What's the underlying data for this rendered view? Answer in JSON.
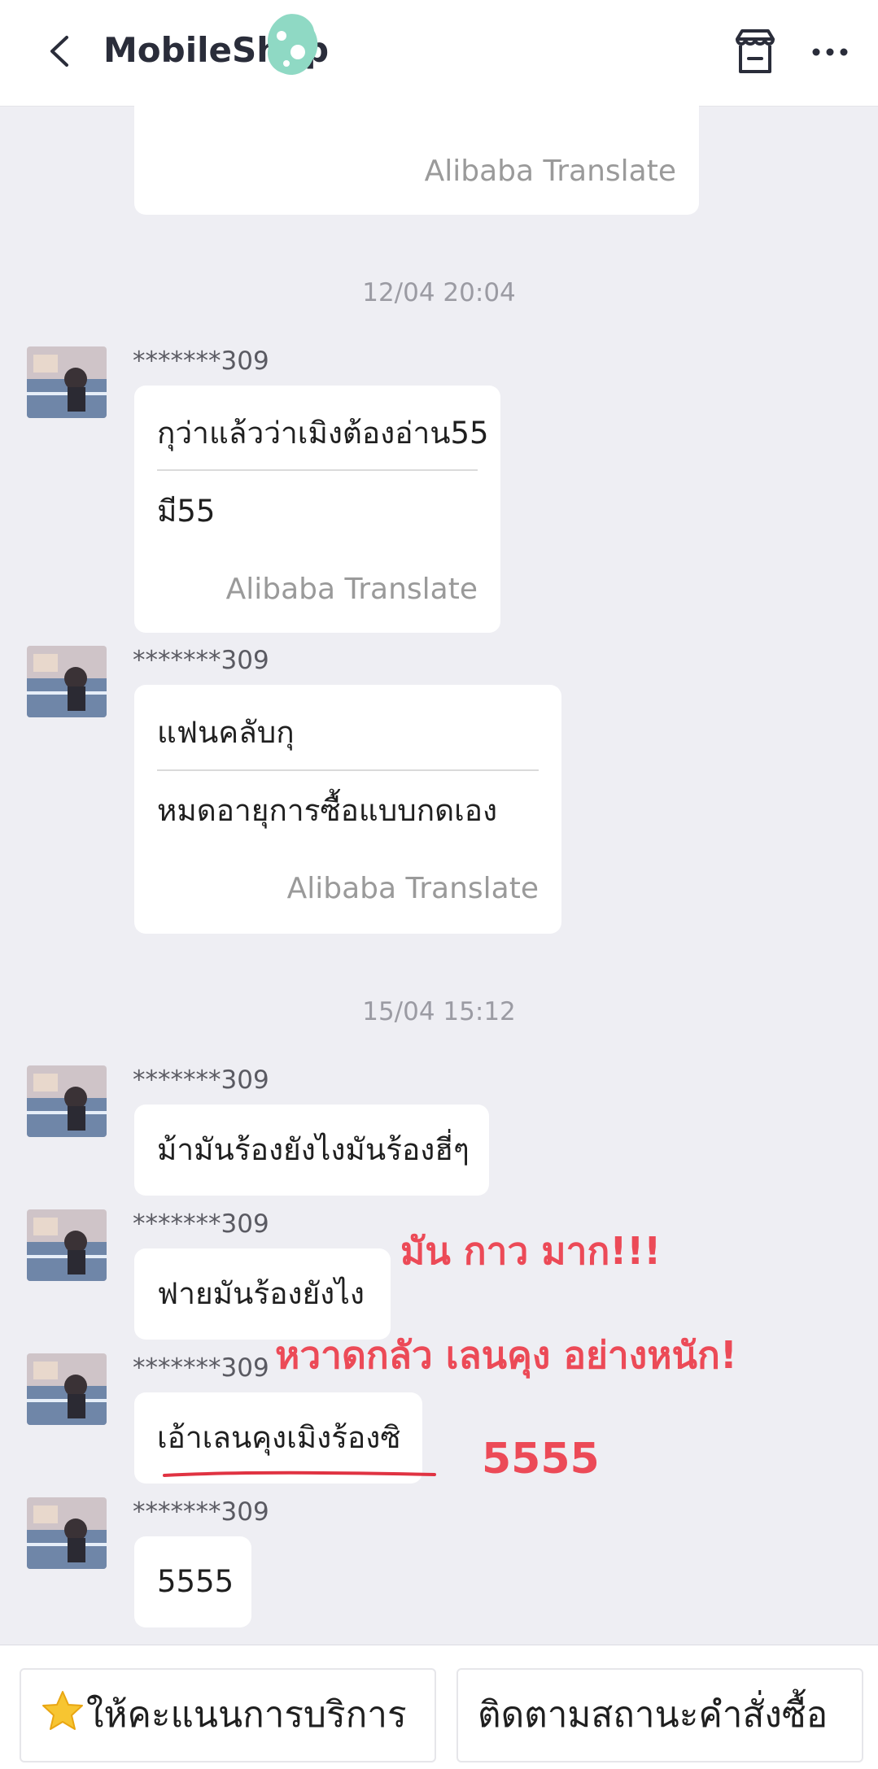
{
  "header": {
    "title": "MobileShop",
    "back_icon": "chevron-left-icon",
    "store_icon": "store-icon",
    "more_icon": "more-horizontal-icon"
  },
  "messages_top": {
    "translate_label": "Alibaba Translate"
  },
  "timestamps": [
    "12/04 20:04",
    "15/04 15:12"
  ],
  "messages": [
    {
      "sender": "*******309",
      "original": "กุว่าแล้วว่าเมิงต้องอ่าน55",
      "translation": "มี55",
      "translate_label": "Alibaba Translate"
    },
    {
      "sender": "*******309",
      "original": "แฟนคลับกุ",
      "translation": "หมดอายุการซื้อแบบกดเอง",
      "translate_label": "Alibaba Translate"
    },
    {
      "sender": "*******309",
      "text": "ม้ามันร้องยังไงมันร้องฮี่ๆ"
    },
    {
      "sender": "*******309",
      "text": "ฟายมันร้องยังไง"
    },
    {
      "sender": "*******309",
      "text": "เอ้าเลนคุงเมิงร้องซิ"
    },
    {
      "sender": "*******309",
      "text": "5555"
    }
  ],
  "annotations": {
    "line1": "มัน กาว มาก!!!",
    "line2": "หวาดกลัว เลนคุง อย่างหนัก!",
    "line3": "5555",
    "color": "#ec4a57"
  },
  "bottom": {
    "rate_label": "ให้คะแนนการบริการ",
    "track_label": "ติดตามสถานะคำสั่งซื้อ",
    "rate_icon": "star-icon"
  }
}
